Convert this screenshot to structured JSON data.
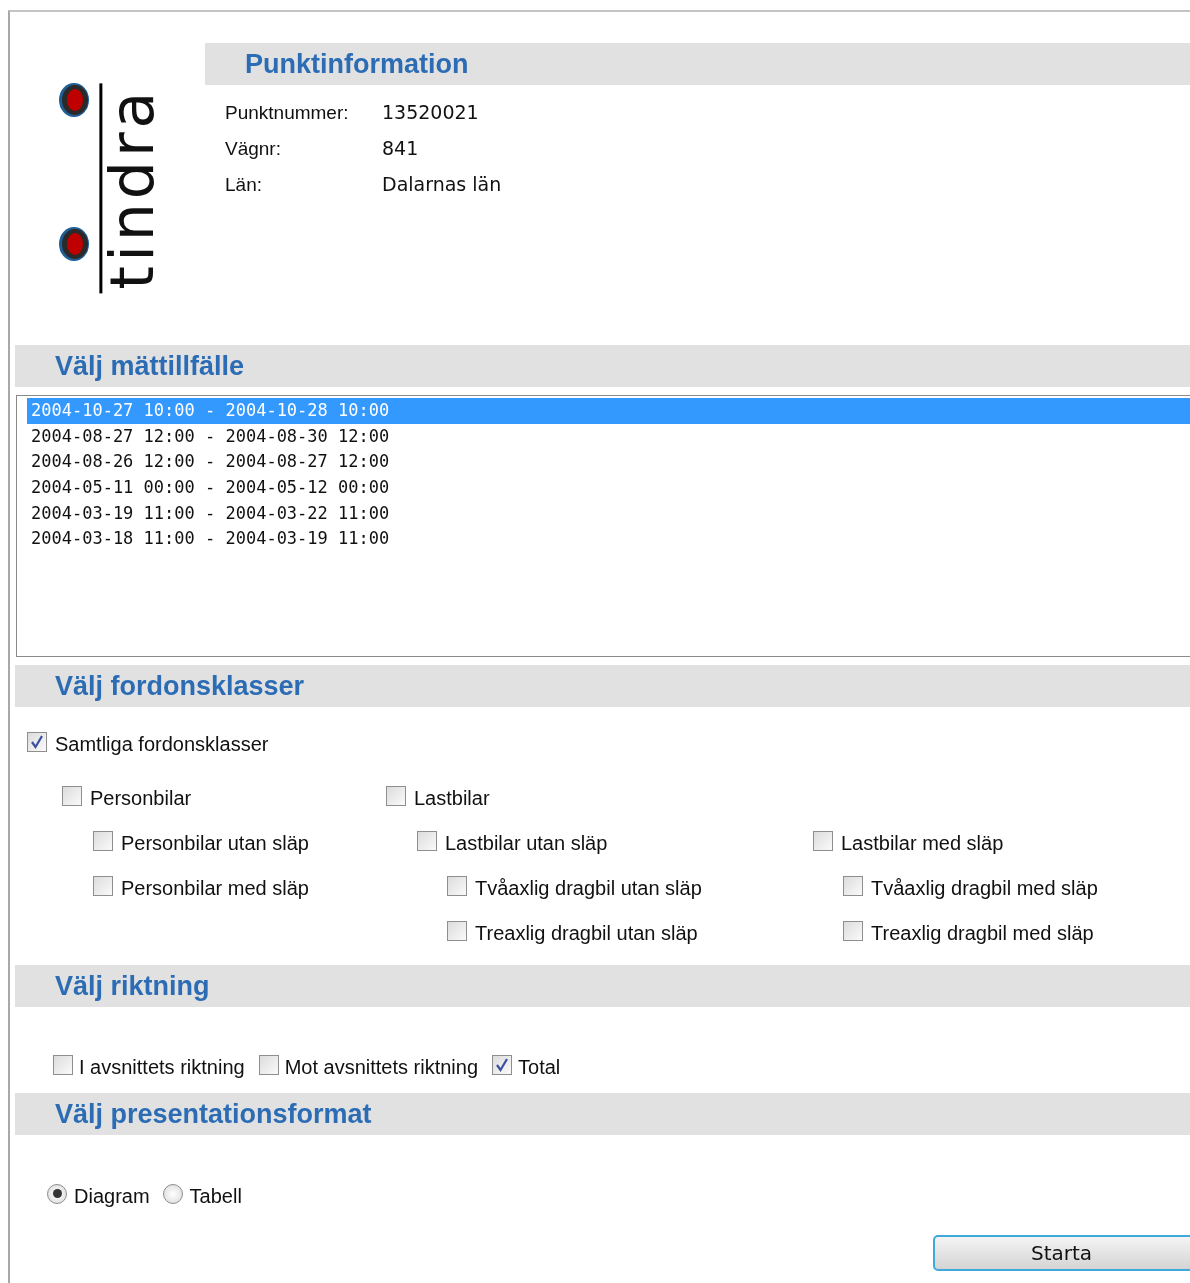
{
  "logo": {
    "text": "tindra"
  },
  "point_info": {
    "title": "Punktinformation",
    "fields": [
      {
        "label": "Punktnummer:",
        "value": "13520021"
      },
      {
        "label": "Vägnr:",
        "value": "841"
      },
      {
        "label": "Län:",
        "value": "Dalarnas län"
      }
    ]
  },
  "periods": {
    "title": "Välj mättillfälle",
    "items": [
      {
        "label": "2004-10-27 10:00 - 2004-10-28 10:00",
        "selected": true
      },
      {
        "label": "2004-08-27 12:00 - 2004-08-30 12:00",
        "selected": false
      },
      {
        "label": "2004-08-26 12:00 - 2004-08-27 12:00",
        "selected": false
      },
      {
        "label": "2004-05-11 00:00 - 2004-05-12 00:00",
        "selected": false
      },
      {
        "label": "2004-03-19 11:00 - 2004-03-22 11:00",
        "selected": false
      },
      {
        "label": "2004-03-18 11:00 - 2004-03-19 11:00",
        "selected": false
      }
    ]
  },
  "vehicle_classes": {
    "title": "Välj fordonsklasser",
    "options": [
      {
        "label": "Samtliga fordonsklasser",
        "checked": true,
        "children": [
          {
            "label": "Personbilar",
            "checked": false,
            "children": [
              {
                "label": "Personbilar utan släp",
                "checked": false
              },
              {
                "label": "Personbilar med släp",
                "checked": false
              }
            ]
          },
          {
            "label": "Lastbilar",
            "checked": false,
            "children": [
              {
                "label": "Lastbilar utan släp",
                "checked": false,
                "children": [
                  {
                    "label": "Tvåaxlig dragbil utan släp",
                    "checked": false
                  },
                  {
                    "label": "Treaxlig dragbil utan släp",
                    "checked": false
                  }
                ]
              },
              {
                "label": "Lastbilar med släp",
                "checked": false,
                "children": [
                  {
                    "label": "Tvåaxlig dragbil med släp",
                    "checked": false
                  },
                  {
                    "label": "Treaxlig dragbil med släp",
                    "checked": false
                  }
                ]
              }
            ]
          }
        ]
      }
    ]
  },
  "direction": {
    "title": "Välj riktning",
    "options": [
      {
        "label": "I avsnittets riktning",
        "checked": false
      },
      {
        "label": "Mot avsnittets riktning",
        "checked": false
      },
      {
        "label": "Total",
        "checked": true
      }
    ]
  },
  "format": {
    "title": "Välj presentationsformat",
    "options": [
      {
        "label": "Diagram",
        "selected": true
      },
      {
        "label": "Tabell",
        "selected": false
      }
    ]
  },
  "start_button": "Starta"
}
